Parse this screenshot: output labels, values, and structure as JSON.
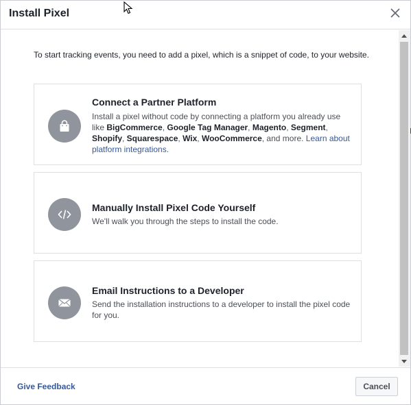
{
  "dialog": {
    "title": "Install Pixel",
    "close_icon": "close-icon"
  },
  "intro": "To start tracking events, you need to add a pixel, which is a snippet of code, to your website.",
  "options": [
    {
      "icon": "shopping-bag-icon",
      "title": "Connect a Partner Platform",
      "desc_parts": [
        "Install a pixel without code by connecting a platform you already use like ",
        "BigCommerce",
        ", ",
        "Google Tag Manager",
        ", ",
        "Magento",
        ", ",
        "Segment",
        ", ",
        "Shopify",
        ", ",
        "Squarespace",
        ", ",
        "Wix",
        ", ",
        "WooCommerce",
        ", and more. "
      ],
      "link": "Learn about platform integrations."
    },
    {
      "icon": "code-icon",
      "title": "Manually Install Pixel Code Yourself",
      "desc": "We'll walk you through the steps to install the code."
    },
    {
      "icon": "envelope-icon",
      "title": "Email Instructions to a Developer",
      "desc": "Send the installation instructions to a developer to install the pixel code for you."
    }
  ],
  "footer": {
    "feedback": "Give Feedback",
    "cancel": "Cancel"
  },
  "colors": {
    "link": "#365899",
    "icon_circle": "#90949c",
    "border": "#dddfe2"
  }
}
